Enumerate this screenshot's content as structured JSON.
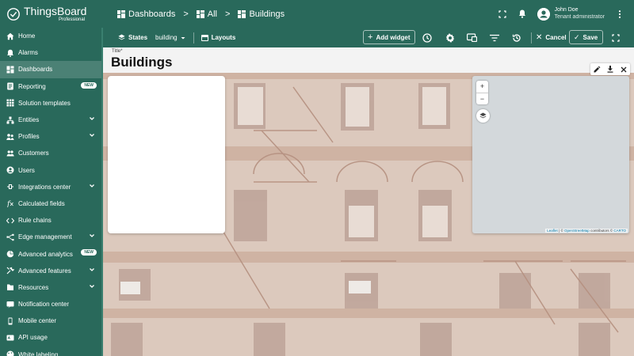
{
  "header": {
    "logo_name": "ThingsBoard",
    "logo_sub": "Professional",
    "breadcrumb": [
      {
        "label": "Dashboards",
        "icon": "dashboard-icon"
      },
      {
        "label": "All",
        "icon": "dashboard-icon"
      },
      {
        "label": "Buildings",
        "icon": "dashboard-icon"
      }
    ],
    "separator": ">",
    "user": {
      "name": "John Doe",
      "role": "Tenant administrator"
    }
  },
  "sidebar": {
    "items": [
      {
        "label": "Home",
        "icon": "home-icon",
        "chevron": false,
        "badge": ""
      },
      {
        "label": "Alarms",
        "icon": "alarm-icon",
        "chevron": false,
        "badge": ""
      },
      {
        "label": "Dashboards",
        "icon": "dashboard-icon",
        "chevron": false,
        "badge": "",
        "active": true
      },
      {
        "label": "Reporting",
        "icon": "report-icon",
        "chevron": false,
        "badge": "NEW"
      },
      {
        "label": "Solution templates",
        "icon": "grid-icon",
        "chevron": false,
        "badge": ""
      },
      {
        "label": "Entities",
        "icon": "entities-icon",
        "chevron": true,
        "badge": ""
      },
      {
        "label": "Profiles",
        "icon": "profiles-icon",
        "chevron": true,
        "badge": ""
      },
      {
        "label": "Customers",
        "icon": "customers-icon",
        "chevron": false,
        "badge": ""
      },
      {
        "label": "Users",
        "icon": "user-icon",
        "chevron": false,
        "badge": ""
      },
      {
        "label": "Integrations center",
        "icon": "integrations-icon",
        "chevron": true,
        "badge": ""
      },
      {
        "label": "Calculated fields",
        "icon": "function-icon",
        "chevron": false,
        "badge": ""
      },
      {
        "label": "Rule chains",
        "icon": "code-icon",
        "chevron": false,
        "badge": ""
      },
      {
        "label": "Edge management",
        "icon": "edge-icon",
        "chevron": true,
        "badge": ""
      },
      {
        "label": "Advanced analytics",
        "icon": "analytics-icon",
        "chevron": false,
        "badge": "NEW"
      },
      {
        "label": "Advanced features",
        "icon": "tools-icon",
        "chevron": true,
        "badge": ""
      },
      {
        "label": "Resources",
        "icon": "resources-icon",
        "chevron": true,
        "badge": ""
      },
      {
        "label": "Notification center",
        "icon": "notification-icon",
        "chevron": false,
        "badge": ""
      },
      {
        "label": "Mobile center",
        "icon": "mobile-icon",
        "chevron": false,
        "badge": ""
      },
      {
        "label": "API usage",
        "icon": "api-icon",
        "chevron": false,
        "badge": ""
      },
      {
        "label": "White labeling",
        "icon": "palette-icon",
        "chevron": false,
        "badge": ""
      }
    ]
  },
  "toolbar": {
    "states_label": "States",
    "states_value": "building",
    "layouts_label": "Layouts",
    "add_widget_label": "Add widget",
    "cancel_label": "Cancel",
    "save_label": "Save"
  },
  "dashboard": {
    "title_label": "Title*",
    "title_value": "Buildings",
    "map": {
      "zoom_in": "+",
      "zoom_out": "−",
      "attribution_leaflet": "Leaflet",
      "attribution_sep": " | © ",
      "attribution_osm": "OpenStreetMap",
      "attribution_mid": " contributors © ",
      "attribution_carto": "CARTO"
    }
  },
  "colors": {
    "primary": "#29695b",
    "accent_white": "#ffffff",
    "map_bg": "#d3d8db"
  }
}
